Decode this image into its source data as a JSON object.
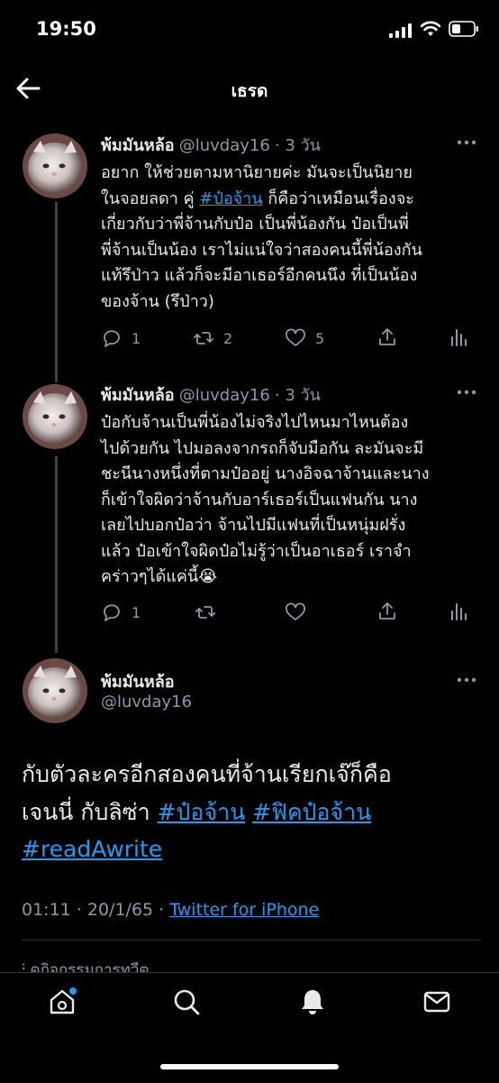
{
  "status_bar": {
    "time": "19:50"
  },
  "header": {
    "title": "เธรด"
  },
  "tweets": [
    {
      "name": "พ้มมันหล้อ",
      "handle": "@luvday16",
      "time": "· 3 วัน",
      "text_lines": [
        "อยาก ให้ช่วยตามหานิยายค่ะ มันจะเป็นนิยาย",
        "ในจอยลดา คู่ ",
        "#ป๋อจ้าน",
        " ก็คือว่าเหมือนเรื่องจะ",
        "เกี่ยวกับว่าพี่จ้านกับป๋อ เป็นพี่น้องกัน ป๋อเป็นพี่",
        "พี่จ้านเป็นน้อง เราไม่แน่ใจว่าสองคนนี้พี่น้องกัน",
        "แท้รึป่าว แล้วก็จะมีอาเธอร์อีกคนนึง ที่เป็นน้อง",
        "ของจ้าน (รึป่าว)"
      ],
      "replies": "1",
      "retweets": "2",
      "likes": "5"
    },
    {
      "name": "พ้มมันหล้อ",
      "handle": "@luvday16",
      "time": "· 3 วัน",
      "text": "ป๋อกับจ้านเป็นพี่น้องไม่จริงไปไหนมาไหนต้อง\nไปด้วยกัน ไปมอลงจากรถก็จับมือกัน ละมันจะมี\nชะนีนางหนึ่งที่ตามป๋ออยู่ นางอิจฉาจ้านและนาง\nก็เข้าใจผิดว่าจ้านกับอาร์เธอร์เป็นแฟนกัน นาง\nเลยไปบอกป๋อว่า จ้านไปมีแฟนที่เป็นหนุ่มฝรั่ง\nแล้ว ป๋อเข้าใจผิดป๋อไม่รู้ว่าเป็นอาเธอร์ เราจำ\nคร่าวๆได้แค่นี้😭",
      "replies": "1"
    }
  ],
  "main_tweet": {
    "name": "พ้มมันหล้อ",
    "handle": "@luvday16",
    "text_plain_1": "กับตัวละครอีกสองคนที่จ้านเรียกเจ๊ก็คือ",
    "text_plain_2": "เจนนี่ กับลิซ่า ",
    "hashtag_1": "#ป๋อจ้าน",
    "hashtag_2": "#ฟิคป๋อจ้าน",
    "hashtag_3": "#readAwrite",
    "timestamp": "01:11 · 20/1/65 · ",
    "source": "Twitter for iPhone",
    "activity": "ดูกิจกรรมการทวีต"
  },
  "colors": {
    "background": "#000000",
    "accent": "#1d9bf0",
    "muted": "#8b98a5",
    "text": "#e7e9ea"
  },
  "icons": [
    "back-arrow-icon",
    "more-icon",
    "reply-icon",
    "retweet-icon",
    "like-icon",
    "share-icon",
    "analytics-icon",
    "home-icon",
    "search-icon",
    "notifications-icon",
    "messages-icon"
  ]
}
